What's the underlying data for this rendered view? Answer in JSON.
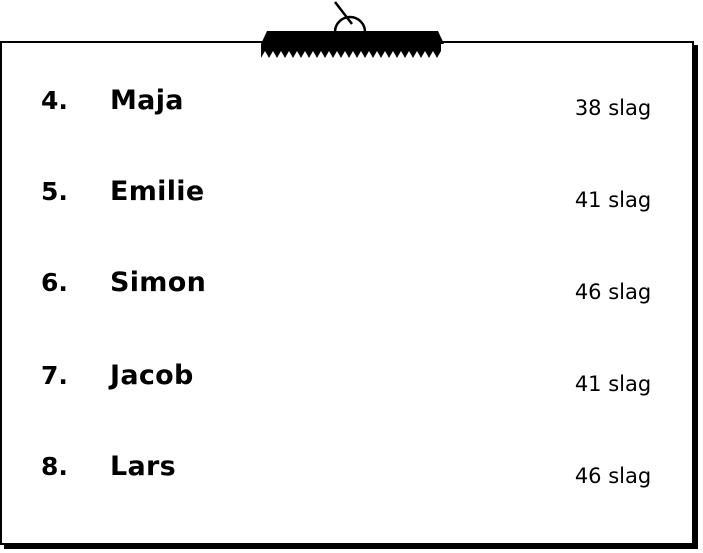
{
  "leaderboard": {
    "rows": [
      {
        "rank": "4.",
        "name": "Maja",
        "score": "38 slag"
      },
      {
        "rank": "5.",
        "name": "Emilie",
        "score": "41 slag"
      },
      {
        "rank": "6.",
        "name": "Simon",
        "score": "46 slag"
      },
      {
        "rank": "7.",
        "name": "Jacob",
        "score": "41 slag"
      },
      {
        "rank": "8.",
        "name": "Lars",
        "score": "46 slag"
      }
    ]
  },
  "colors": {
    "ink": "#000000",
    "paper": "#ffffff"
  },
  "icons": {
    "clip": "paper-clip-icon"
  }
}
